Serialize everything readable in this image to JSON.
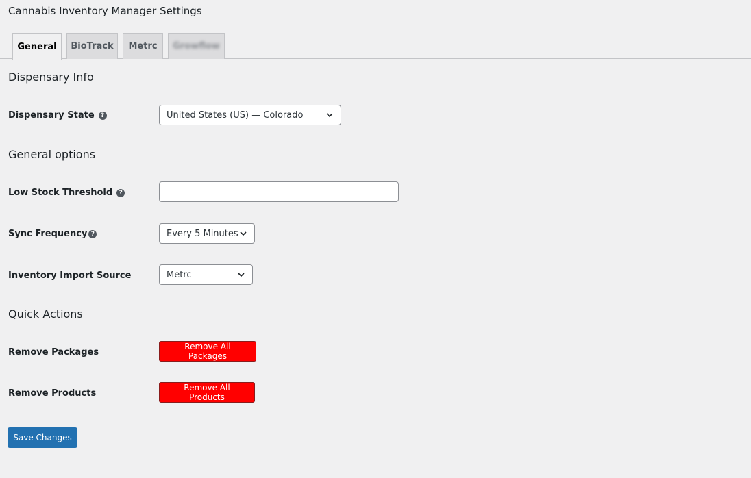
{
  "page": {
    "title": "Cannabis Inventory Manager Settings"
  },
  "tabs": [
    {
      "label": "General",
      "active": true
    },
    {
      "label": "BioTrack",
      "active": false
    },
    {
      "label": "Metrc",
      "active": false
    },
    {
      "label": "Growflow",
      "active": false,
      "blurred": true
    }
  ],
  "sections": {
    "dispensary_info": "Dispensary Info",
    "general_options": "General options",
    "quick_actions": "Quick Actions"
  },
  "fields": {
    "dispensary_state": {
      "label": "Dispensary State",
      "value": "United States (US) — Colorado",
      "help_icon": "question-circle-icon"
    },
    "low_stock_threshold": {
      "label": "Low Stock Threshold",
      "value": "",
      "help_icon": "question-circle-icon"
    },
    "sync_frequency": {
      "label": "Sync Frequency",
      "value": "Every 5 Minutes",
      "help_icon": "question-circle-icon"
    },
    "inventory_import_source": {
      "label": "Inventory Import Source",
      "value": "Metrc"
    }
  },
  "actions": {
    "remove_packages": {
      "label": "Remove Packages",
      "button": "Remove All Packages"
    },
    "remove_products": {
      "label": "Remove Products",
      "button": "Remove All Products"
    }
  },
  "save_button": "Save Changes",
  "colors": {
    "background": "#f0f0f1",
    "primary": "#2271b1",
    "danger": "#ff0000"
  }
}
